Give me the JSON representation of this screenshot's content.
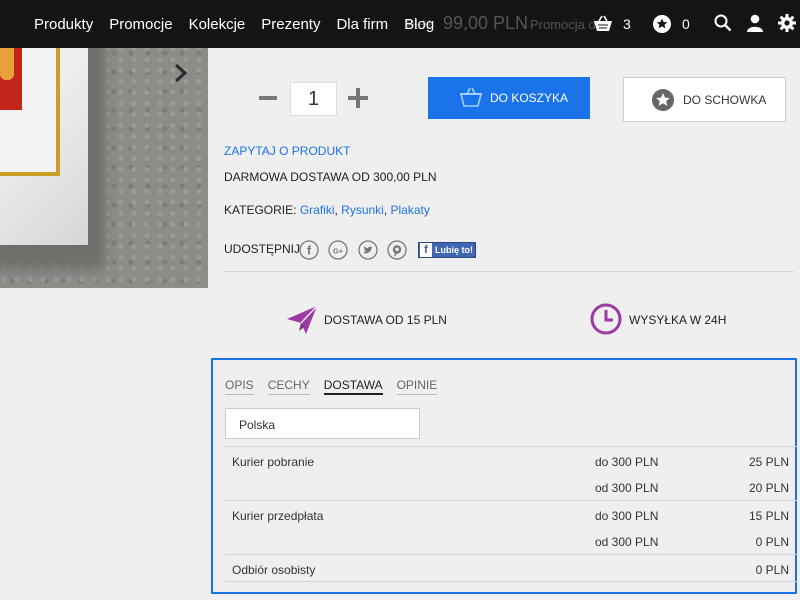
{
  "nav": {
    "menu": [
      "Produkty",
      "Promocje",
      "Kolekcje",
      "Prezenty",
      "Dla firm",
      "Blog"
    ],
    "ghost_old_price": "PLN",
    "ghost_price": "99,00 PLN",
    "ghost_promo": "Promocja d",
    "cart_count": "3",
    "wishlist_count": "0"
  },
  "product": {
    "quantity": "1",
    "add_to_cart": "DO KOSZYKA",
    "add_to_wishlist": "DO SCHOWKA",
    "ask_link": "ZAPYTAJ O PRODUKT",
    "free_shipping": "DARMOWA DOSTAWA OD 300,00 PLN",
    "categories_label": "KATEGORIE:",
    "categories": [
      "Grafiki",
      "Rysunki",
      "Plakaty"
    ],
    "share_label": "UDOSTĘPNIJ",
    "fb_like": "Lubię to!"
  },
  "features": [
    {
      "icon": "paper-plane-icon",
      "label": "DOSTAWA OD 15 PLN",
      "color": "#9b3aa3"
    },
    {
      "icon": "clock-icon",
      "label": "WYSYŁKA W 24H",
      "color": "#9b3aa3"
    }
  ],
  "tabs": [
    {
      "label": "OPIS",
      "active": false
    },
    {
      "label": "CECHY",
      "active": false
    },
    {
      "label": "DOSTAWA",
      "active": true
    },
    {
      "label": "OPINIE",
      "active": false
    }
  ],
  "shipping": {
    "country": "Polska",
    "rows": [
      {
        "name": "Kurier pobranie",
        "range": "do 300 PLN",
        "price": "25 PLN"
      },
      {
        "name": "",
        "range": "od 300 PLN",
        "price": "20 PLN"
      },
      {
        "name": "Kurier przedpłata",
        "range": "do 300 PLN",
        "price": "15 PLN"
      },
      {
        "name": "",
        "range": "od 300 PLN",
        "price": "0 PLN"
      },
      {
        "name": "Odbiór osobisty",
        "range": "",
        "price": "0 PLN"
      }
    ]
  },
  "colors": {
    "accent": "#1a73e8",
    "feature_icon": "#9b3aa3",
    "nav_bg": "#141414"
  }
}
